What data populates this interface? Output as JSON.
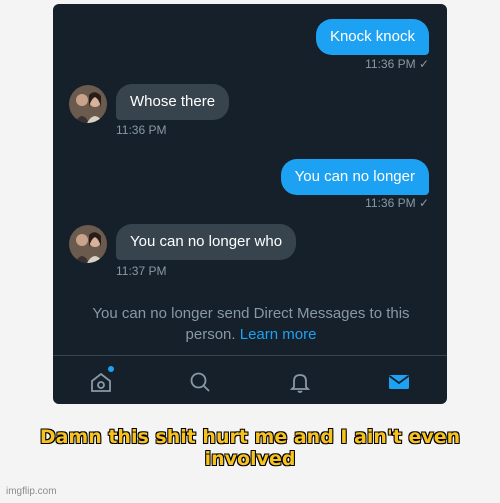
{
  "messages": [
    {
      "direction": "out",
      "text": "Knock knock",
      "time": "11:36 PM",
      "status": "✓"
    },
    {
      "direction": "in",
      "text": "Whose there",
      "time": "11:36 PM"
    },
    {
      "direction": "out",
      "text": "You can no longer",
      "time": "11:36 PM",
      "status": "✓"
    },
    {
      "direction": "in",
      "text": "You can no longer who",
      "time": "11:37 PM"
    }
  ],
  "notice": {
    "text": "You can no longer send Direct Messages to this person.",
    "link": "Learn more"
  },
  "tabs": [
    {
      "icon": "home-icon",
      "notification": true
    },
    {
      "icon": "search-icon"
    },
    {
      "icon": "bell-icon"
    },
    {
      "icon": "mail-icon",
      "active": true
    }
  ],
  "meme": {
    "caption_line1": "Damn this shit hurt me and I ain't even",
    "caption_line2": "involved"
  },
  "watermark": "imgflip.com",
  "colors": {
    "background": "#15202b",
    "accent": "#1da1f2",
    "incoming_bubble": "#38444d",
    "caption": "#f8c21e"
  }
}
